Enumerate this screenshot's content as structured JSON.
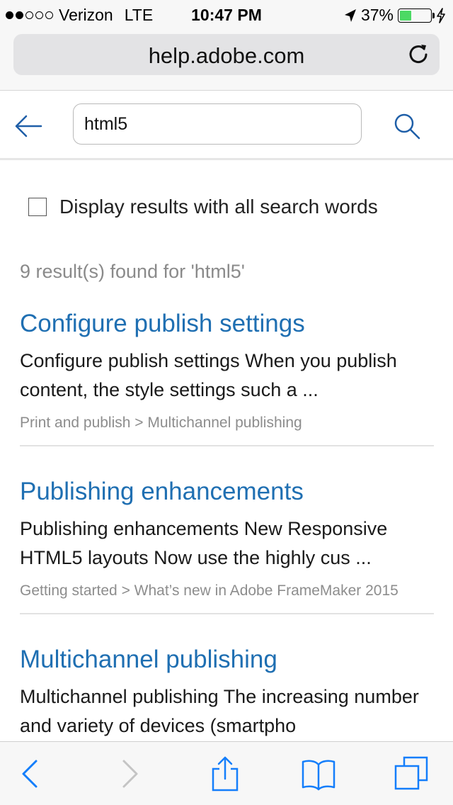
{
  "status_bar": {
    "carrier": "Verizon",
    "network": "LTE",
    "time": "10:47 PM",
    "battery": "37%",
    "battery_level": 0.37,
    "signal_bars": 2,
    "icons": [
      "signal-dots-icon",
      "location-arrow-icon",
      "battery-icon",
      "charging-bolt-icon"
    ]
  },
  "browser": {
    "url": "help.adobe.com",
    "reload_icon": "reload-icon"
  },
  "search": {
    "value": "html5",
    "back_icon": "back-arrow-icon",
    "search_icon": "search-icon"
  },
  "filter": {
    "all_words_label": "Display results with all search words",
    "all_words_checked": false
  },
  "results_count": "9 result(s) found for 'html5'",
  "results": [
    {
      "title": "Configure publish settings",
      "snippet": "Configure publish settings When you publish content, the style settings such a ...",
      "breadcrumb": "Print and publish > Multichannel publishing"
    },
    {
      "title": "Publishing enhancements",
      "snippet": "Publishing enhancements New Responsive HTML5 layouts Now use the highly cus ...",
      "breadcrumb": "Getting started > What’s new in Adobe FrameMaker 2015"
    },
    {
      "title": "Multichannel publishing",
      "snippet": "Multichannel publishing The increasing number and variety of devices (smartpho",
      "breadcrumb": ""
    }
  ],
  "toolbar": {
    "icons": [
      "back-icon",
      "forward-icon",
      "share-icon",
      "bookmarks-icon",
      "tabs-icon"
    ]
  },
  "colors": {
    "link": "#1f6fb2",
    "ios_blue": "#147efb",
    "battery_green": "#4cd964",
    "muted_text": "#8a8a8a"
  }
}
